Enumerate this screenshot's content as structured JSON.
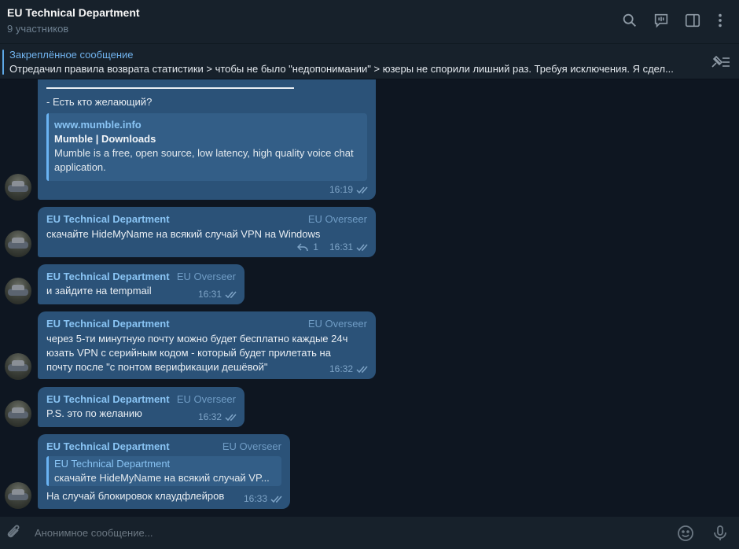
{
  "header": {
    "title": "EU Technical Department",
    "subtitle": "9 участников"
  },
  "icons": {
    "search": "search-icon",
    "voice_chat": "voice-chat-icon",
    "sidebar": "sidebar-toggle-icon",
    "more": "more-vertical-icon"
  },
  "pinned": {
    "title": "Закреплённое сообщение",
    "text": "Отредачил правила возврата статистики > чтобы не было \"недопонимании\" > юзеры не спорили лишний раз. Требуя исключения. Я сдел..."
  },
  "messages": [
    {
      "text": "- Есть кто желающий?",
      "link": {
        "url": "www.mumble.info",
        "title": "Mumble | Downloads",
        "desc_line1": "Mumble is a free, open source, low latency, high quality voice chat",
        "desc_line2": "application."
      },
      "time": "16:19"
    },
    {
      "sender": "EU Technical Department",
      "role": "EU Overseer",
      "text": "скачайте HideMyName на всякий случай VPN на Windows",
      "replies": "1",
      "time": "16:31"
    },
    {
      "sender": "EU Technical Department",
      "role": "EU Overseer",
      "text": "и зайдите на tempmail",
      "time": "16:31"
    },
    {
      "sender": "EU Technical Department",
      "role": "EU Overseer",
      "line1": "через 5-ти минутную почту можно будет бесплатно каждые 24ч",
      "line2": "юзать VPN с серийным кодом - который будет прилетать на",
      "line3": "почту после \"с понтом верификации дешёвой\"",
      "time": "16:32"
    },
    {
      "sender": "EU Technical Department",
      "role": "EU Overseer",
      "text": "P.S. это по желанию",
      "time": "16:32"
    },
    {
      "sender": "EU Technical Department",
      "role": "EU Overseer",
      "reply_to": {
        "sender": "EU Technical Department",
        "text": "скачайте HideMyName на всякий случай VP..."
      },
      "text": "На случай блокировок клаудфлейров",
      "time": "16:33"
    }
  ],
  "composer": {
    "placeholder": "Анонимное сообщение..."
  },
  "colors": {
    "background": "#0e1621",
    "panel": "#17212b",
    "bubble": "#2b5278",
    "accent": "#89c4f4"
  }
}
